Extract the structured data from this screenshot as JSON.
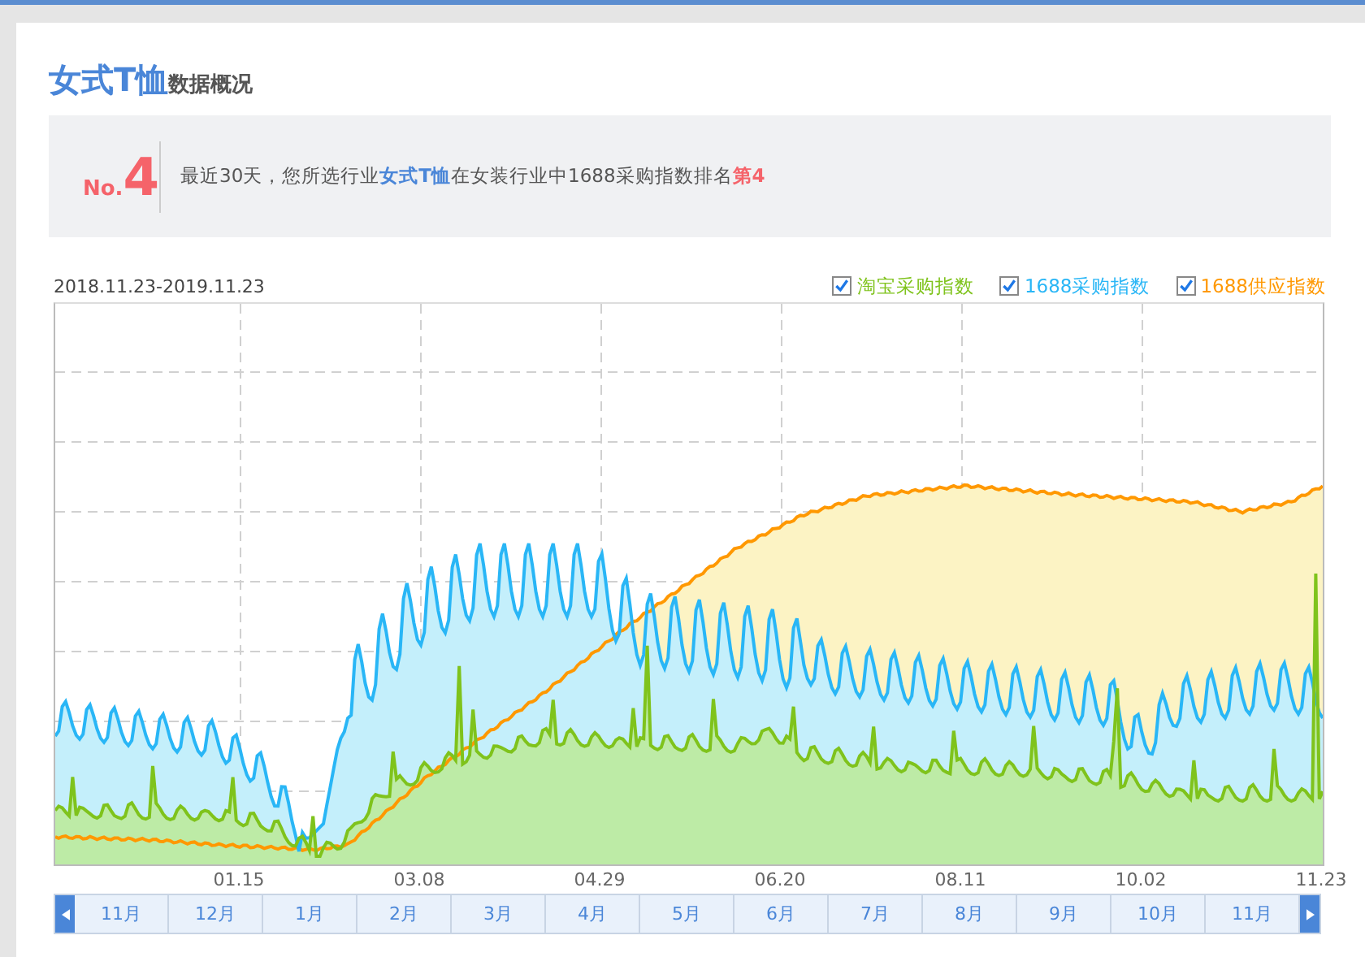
{
  "title": {
    "category": "女式T恤",
    "suffix": "数据概况"
  },
  "banner": {
    "prefix": "No.",
    "number": "4",
    "message": [
      {
        "kind": "plain",
        "text": "最近30天，您所选行业"
      },
      {
        "kind": "category",
        "text": "女式T恤"
      },
      {
        "kind": "plain",
        "text": "在女装行业中1688采购指数排名"
      },
      {
        "kind": "rank",
        "text": "第4"
      }
    ]
  },
  "date_range": "2018.11.23-2019.11.23",
  "legend": [
    {
      "label": "淘宝采购指数",
      "checked": true,
      "color": "#7fc31c"
    },
    {
      "label": "1688采购指数",
      "checked": true,
      "color": "#29b6f6"
    },
    {
      "label": "1688供应指数",
      "checked": true,
      "color": "#ff9800"
    }
  ],
  "x_labels": [
    "01.15",
    "03.08",
    "04.29",
    "06.20",
    "08.11",
    "10.02",
    "11.23"
  ],
  "months": [
    "11月",
    "12月",
    "1月",
    "2月",
    "3月",
    "4月",
    "5月",
    "6月",
    "7月",
    "8月",
    "9月",
    "10月",
    "11月"
  ]
}
